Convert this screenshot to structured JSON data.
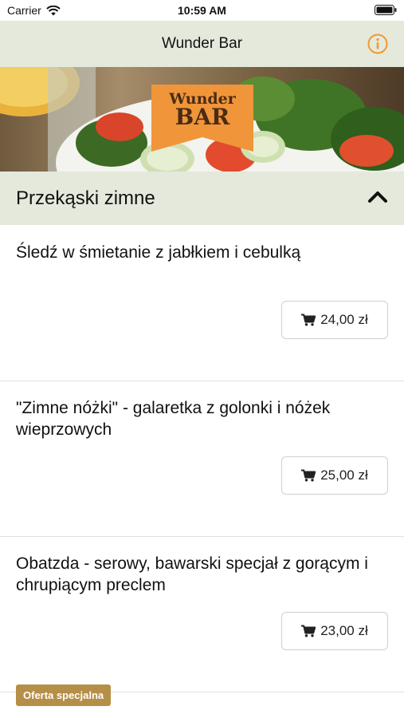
{
  "status": {
    "carrier": "Carrier",
    "time": "10:59 AM"
  },
  "nav": {
    "title": "Wunder Bar"
  },
  "banner": {
    "logo_line1": "Wunder",
    "logo_line2": "BAR"
  },
  "section": {
    "title": "Przekąski zimne"
  },
  "items": [
    {
      "name": "Śledź w śmietanie z jabłkiem i cebulką",
      "price": "24,00 zł"
    },
    {
      "name": "\"Zimne nóżki\" - galaretka z golonki i nóżek wieprzowych",
      "price": "25,00 zł"
    },
    {
      "name": "Obatzda - serowy, bawarski specjał z gorącym i chrupiącym preclem",
      "price": "23,00 zł"
    }
  ],
  "badge": {
    "label": "Oferta specjalna"
  },
  "colors": {
    "header_bg": "#e4e9db",
    "accent": "#f29a2e",
    "badge_bg": "#b58e48"
  },
  "icons": {
    "info": "info-icon",
    "collapse": "chevron-up-icon",
    "cart": "cart-icon"
  }
}
